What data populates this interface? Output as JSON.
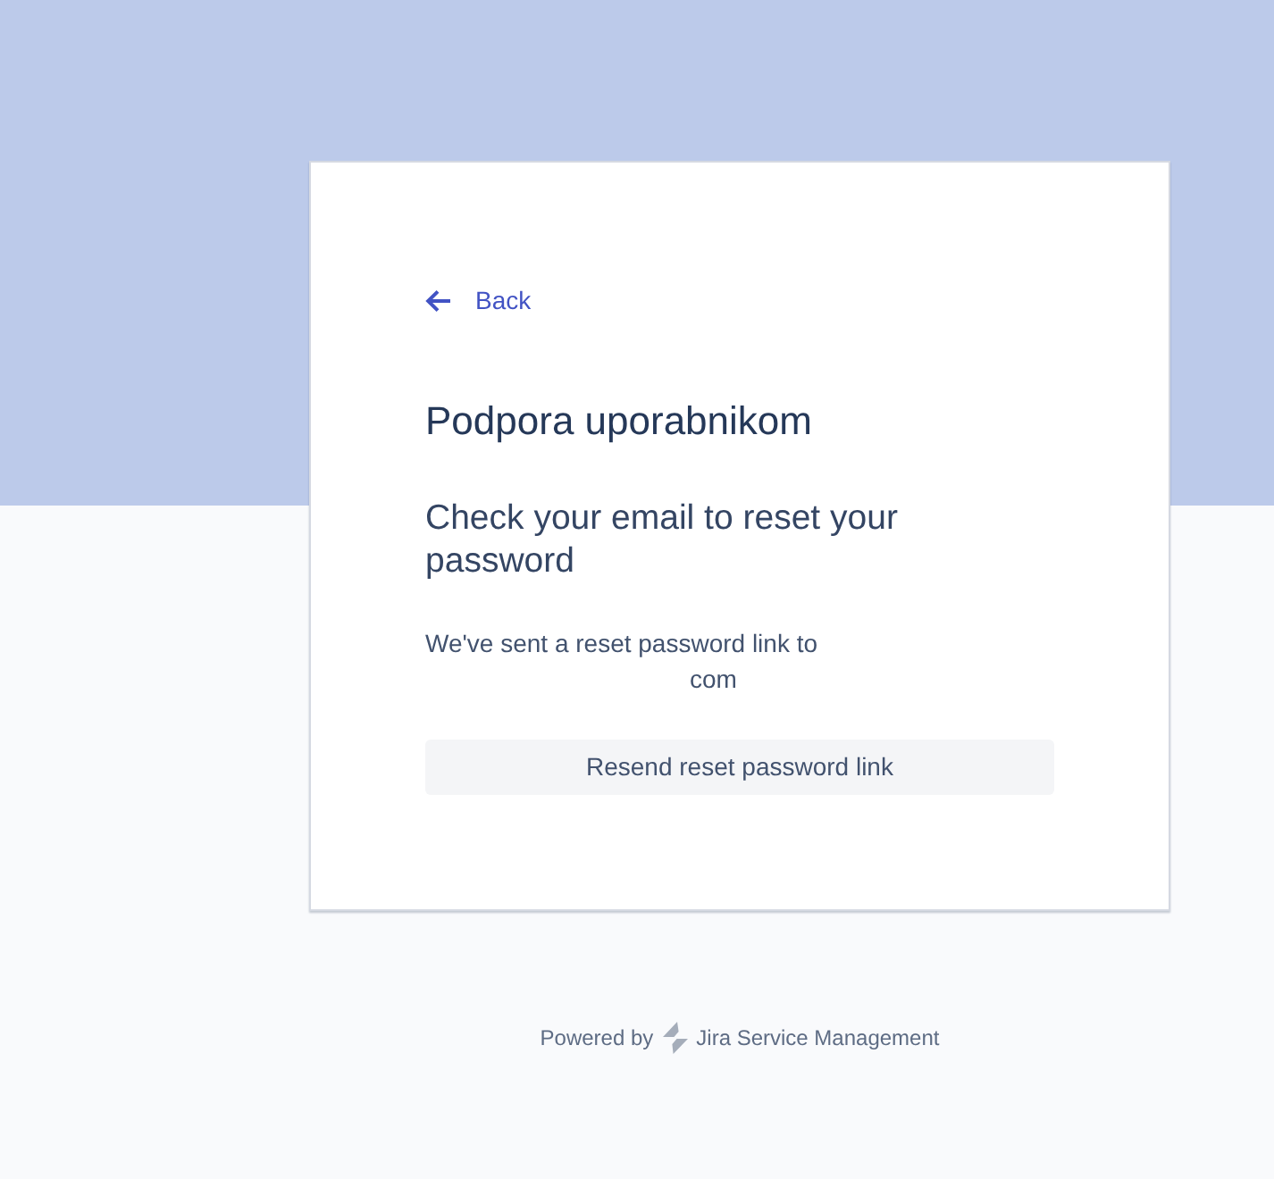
{
  "card": {
    "back_link": "Back",
    "portal_title": "Podpora uporabnikom",
    "heading": "Check your email to reset your password",
    "message": "We've sent a reset password link to",
    "email": "com",
    "button": "Resend reset password link"
  },
  "footer": {
    "prefix": "Powered by",
    "product": "Jira Service Management"
  }
}
